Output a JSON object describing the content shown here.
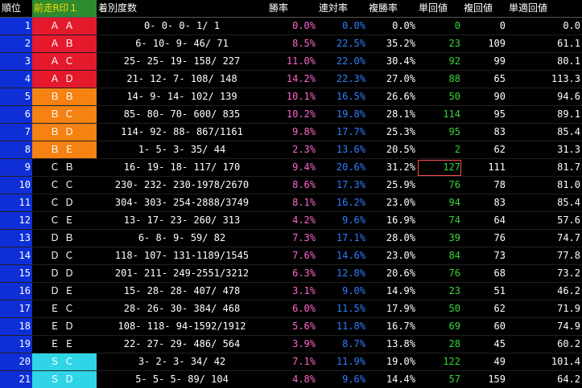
{
  "headers": {
    "rank": "順位",
    "mark": "前走R印１",
    "record": "着別度数",
    "win": "勝率",
    "place2": "連対率",
    "place3": "複勝率",
    "win_ret": "単回値",
    "place_ret": "複回値",
    "adj_ret": "単適回値"
  },
  "rows": [
    {
      "rank": "1",
      "mark": "ＡＡ",
      "record": "0-    0-    0-    1/    1",
      "win": "0.0%",
      "place2": "0.0%",
      "place3": "0.0%",
      "win_ret": "0",
      "place_ret": "0",
      "adj_ret": "0.0"
    },
    {
      "rank": "2",
      "mark": "ＡＢ",
      "record": "6-   10-    9-   46/   71",
      "win": "8.5%",
      "place2": "22.5%",
      "place3": "35.2%",
      "win_ret": "23",
      "place_ret": "109",
      "adj_ret": "61.1"
    },
    {
      "rank": "3",
      "mark": "ＡＣ",
      "record": "25-   25-   19-  158/  227",
      "win": "11.0%",
      "place2": "22.0%",
      "place3": "30.4%",
      "win_ret": "92",
      "place_ret": "99",
      "adj_ret": "80.1"
    },
    {
      "rank": "4",
      "mark": "ＡＤ",
      "record": "21-   12-    7-  108/  148",
      "win": "14.2%",
      "place2": "22.3%",
      "place3": "27.0%",
      "win_ret": "88",
      "place_ret": "65",
      "adj_ret": "113.3"
    },
    {
      "rank": "5",
      "mark": "ＢＢ",
      "record": "14-    9-   14-  102/  139",
      "win": "10.1%",
      "place2": "16.5%",
      "place3": "26.6%",
      "win_ret": "50",
      "place_ret": "90",
      "adj_ret": "94.6"
    },
    {
      "rank": "6",
      "mark": "ＢＣ",
      "record": "85-   80-   70-  600/  835",
      "win": "10.2%",
      "place2": "19.8%",
      "place3": "28.1%",
      "win_ret": "114",
      "place_ret": "95",
      "adj_ret": "89.1"
    },
    {
      "rank": "7",
      "mark": "ＢＤ",
      "record": "114-   92-   88-  867/1161",
      "win": "9.8%",
      "place2": "17.7%",
      "place3": "25.3%",
      "win_ret": "95",
      "place_ret": "83",
      "adj_ret": "85.4"
    },
    {
      "rank": "8",
      "mark": "ＢＥ",
      "record": "1-    5-    3-   35/   44",
      "win": "2.3%",
      "place2": "13.6%",
      "place3": "20.5%",
      "win_ret": "2",
      "place_ret": "62",
      "adj_ret": "31.3"
    },
    {
      "rank": "9",
      "mark": "ＣＢ",
      "record": "16-   19-   18-  117/  170",
      "win": "9.4%",
      "place2": "20.6%",
      "place3": "31.2%",
      "win_ret": "127",
      "place_ret": "111",
      "adj_ret": "81.7"
    },
    {
      "rank": "10",
      "mark": "ＣＣ",
      "record": "230- 232- 230-1978/2670",
      "win": "8.6%",
      "place2": "17.3%",
      "place3": "25.9%",
      "win_ret": "76",
      "place_ret": "78",
      "adj_ret": "81.0"
    },
    {
      "rank": "11",
      "mark": "ＣＤ",
      "record": "304- 303- 254-2888/3749",
      "win": "8.1%",
      "place2": "16.2%",
      "place3": "23.0%",
      "win_ret": "94",
      "place_ret": "83",
      "adj_ret": "85.4"
    },
    {
      "rank": "12",
      "mark": "ＣＥ",
      "record": "13-   17-   23-  260/  313",
      "win": "4.2%",
      "place2": "9.6%",
      "place3": "16.9%",
      "win_ret": "74",
      "place_ret": "64",
      "adj_ret": "57.6"
    },
    {
      "rank": "13",
      "mark": "ＤＢ",
      "record": "6-    8-    9-   59/   82",
      "win": "7.3%",
      "place2": "17.1%",
      "place3": "28.0%",
      "win_ret": "39",
      "place_ret": "76",
      "adj_ret": "74.7"
    },
    {
      "rank": "14",
      "mark": "ＤＣ",
      "record": "118- 107- 131-1189/1545",
      "win": "7.6%",
      "place2": "14.6%",
      "place3": "23.0%",
      "win_ret": "84",
      "place_ret": "73",
      "adj_ret": "77.8"
    },
    {
      "rank": "15",
      "mark": "ＤＤ",
      "record": "201- 211- 249-2551/3212",
      "win": "6.3%",
      "place2": "12.8%",
      "place3": "20.6%",
      "win_ret": "76",
      "place_ret": "68",
      "adj_ret": "73.2"
    },
    {
      "rank": "16",
      "mark": "ＤＥ",
      "record": "15-   28-   28-  407/  478",
      "win": "3.1%",
      "place2": "9.0%",
      "place3": "14.9%",
      "win_ret": "23",
      "place_ret": "51",
      "adj_ret": "46.2"
    },
    {
      "rank": "17",
      "mark": "ＥＣ",
      "record": "28-   26-   30-  384/  468",
      "win": "6.0%",
      "place2": "11.5%",
      "place3": "17.9%",
      "win_ret": "50",
      "place_ret": "62",
      "adj_ret": "71.9"
    },
    {
      "rank": "18",
      "mark": "ＥＤ",
      "record": "108- 118-   94-1592/1912",
      "win": "5.6%",
      "place2": "11.8%",
      "place3": "16.7%",
      "win_ret": "69",
      "place_ret": "60",
      "adj_ret": "74.9"
    },
    {
      "rank": "19",
      "mark": "ＥＥ",
      "record": "22-   27-   29-  486/  564",
      "win": "3.9%",
      "place2": "8.7%",
      "place3": "13.8%",
      "win_ret": "28",
      "place_ret": "45",
      "adj_ret": "60.2"
    },
    {
      "rank": "20",
      "mark": "ＳＣ",
      "record": "3-    2-    3-   34/   42",
      "win": "7.1%",
      "place2": "11.9%",
      "place3": "19.0%",
      "win_ret": "122",
      "place_ret": "49",
      "adj_ret": "101.4"
    },
    {
      "rank": "21",
      "mark": "ＳＤ",
      "record": "5-    5-    5-   89/  104",
      "win": "4.8%",
      "place2": "9.6%",
      "place3": "14.4%",
      "win_ret": "57",
      "place_ret": "159",
      "adj_ret": "64.2"
    }
  ]
}
